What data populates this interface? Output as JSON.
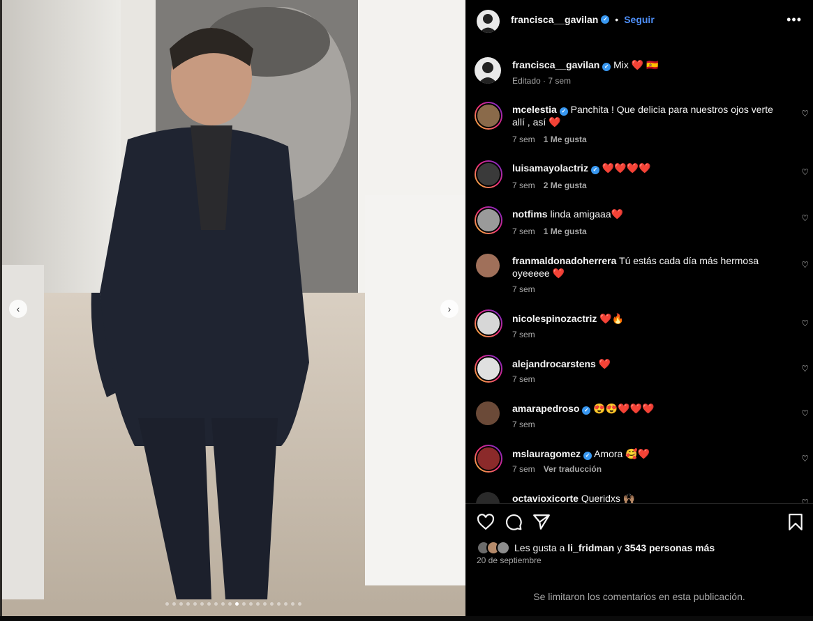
{
  "post": {
    "username": "francisca__gavilan",
    "follow_label": "Seguir",
    "separator": "•",
    "caption_text": "Mix ❤️ 🇪🇸",
    "caption_meta": "Editado · 7 sem"
  },
  "comments": [
    {
      "user": "mcelestia",
      "verified": true,
      "text": "Panchita ! Que delicia para nuestros ojos verte allí , así ❤️",
      "time": "7 sem",
      "extra": "1 Me gusta"
    },
    {
      "user": "luisamayolactriz",
      "verified": true,
      "text": "❤️❤️❤️❤️",
      "time": "7 sem",
      "extra": "2 Me gusta"
    },
    {
      "user": "notfims",
      "verified": false,
      "text": "linda amigaaa❤️",
      "time": "7 sem",
      "extra": "1 Me gusta"
    },
    {
      "user": "franmaldonadoherrera",
      "verified": false,
      "text": "Tú estás cada día más hermosa oyeeeee ❤️",
      "time": "7 sem",
      "extra": ""
    },
    {
      "user": "nicolespinozactriz",
      "verified": false,
      "text": "❤️🔥",
      "time": "7 sem",
      "extra": ""
    },
    {
      "user": "alejandrocarstens",
      "verified": false,
      "text": "❤️",
      "time": "7 sem",
      "extra": ""
    },
    {
      "user": "amarapedroso",
      "verified": true,
      "text": "😍😍❤️❤️❤️",
      "time": "7 sem",
      "extra": ""
    },
    {
      "user": "mslauragomez",
      "verified": true,
      "text": "Amora 🥰❤️",
      "time": "7 sem",
      "extra": "Ver traducción"
    },
    {
      "user": "octavioxicorte",
      "verified": false,
      "text": "Queridxs 🙌🏽",
      "time": "",
      "extra": ""
    }
  ],
  "likes": {
    "prefix": "Les gusta a",
    "user": "li_fridman",
    "conj": "y",
    "count": "3543 personas más"
  },
  "date": "20 de septiembre",
  "limited_comments": "Se limitaron los comentarios en esta publicación.",
  "carousel": {
    "total": 20,
    "active": 11
  },
  "icons": {
    "verified": "verified-badge-icon",
    "more": "more-options-icon",
    "like": "heart-icon",
    "comment": "comment-bubble-icon",
    "share": "paper-plane-icon",
    "save": "bookmark-icon",
    "prev": "chevron-left-icon",
    "next": "chevron-right-icon"
  },
  "colors": {
    "accent": "#4e8ff8",
    "verified": "#3897f0",
    "muted": "#a8a8a8"
  }
}
